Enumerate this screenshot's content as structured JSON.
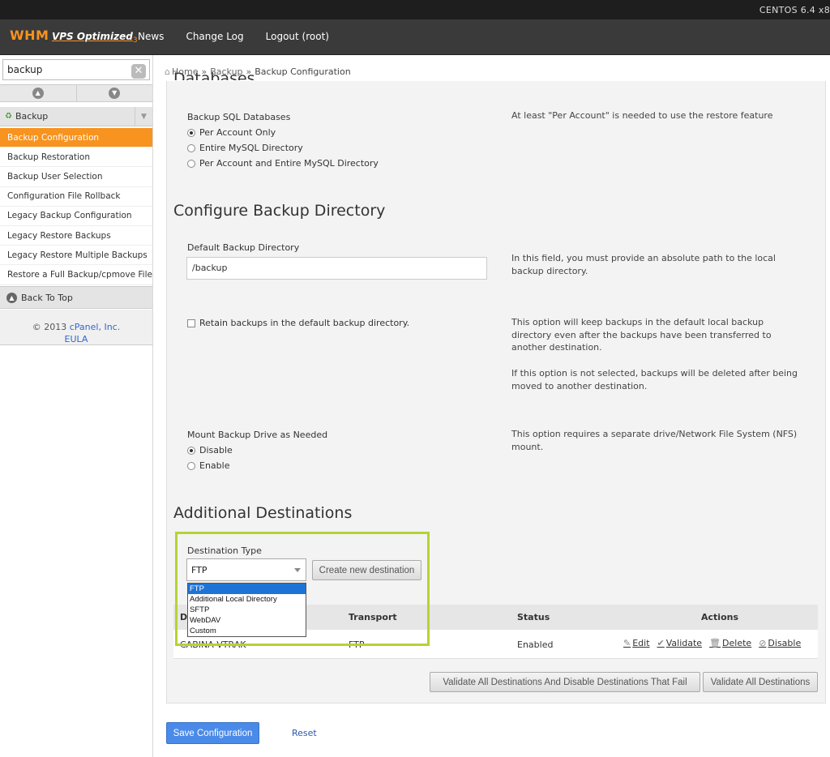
{
  "os": {
    "label": "CENTOS 6.4 x8"
  },
  "header": {
    "logo_whm": "WHM",
    "logo_vps": "VPS Optimized",
    "logo_version": "3",
    "nav": [
      "News",
      "Change Log",
      "Logout (root)"
    ]
  },
  "sidebar": {
    "search_value": "backup",
    "clear_glyph": "✕",
    "group_label": "Backup",
    "items": [
      "Backup Configuration",
      "Backup Restoration",
      "Backup User Selection",
      "Configuration File Rollback",
      "Legacy Backup Configuration",
      "Legacy Restore Backups",
      "Legacy Restore Multiple Backups",
      "Restore a Full Backup/cpmove File"
    ],
    "active_index": 0,
    "back_to_top": "Back To Top",
    "copyright_prefix": "© 2013 ",
    "copyright_link": "cPanel, Inc.",
    "eula": "EULA"
  },
  "breadcrumb": {
    "home": "Home",
    "sep": "»",
    "items": [
      "Backup",
      "Backup Configuration"
    ]
  },
  "clipped_section_title": "Databases",
  "sql": {
    "label": "Backup SQL Databases",
    "options": [
      "Per Account Only",
      "Entire MySQL Directory",
      "Per Account and Entire MySQL Directory"
    ],
    "selected": 0,
    "help": "At least \"Per Account\" is needed to use the restore feature"
  },
  "directory": {
    "title": "Configure Backup Directory",
    "label": "Default Backup Directory",
    "value": "/backup",
    "help": "In this field, you must provide an absolute path to the local backup directory.",
    "retain_label": "Retain backups in the default backup directory.",
    "retain_help_1": "This option will keep backups in the default local backup directory even after the backups have been transferred to another destination.",
    "retain_help_2": "If this option is not selected, backups will be deleted after being moved to another destination."
  },
  "mount": {
    "label": "Mount Backup Drive as Needed",
    "options": [
      "Disable",
      "Enable"
    ],
    "selected": 0,
    "help": "This option requires a separate drive/Network File System (NFS) mount."
  },
  "destinations": {
    "title": "Additional Destinations",
    "type_label": "Destination Type",
    "selected_type": "FTP",
    "type_options": [
      "FTP",
      "Additional Local Directory",
      "SFTP",
      "WebDAV",
      "Custom"
    ],
    "create_button": "Create new destination",
    "columns": [
      "D",
      "Transport",
      "Status",
      "Actions"
    ],
    "rows": [
      {
        "name": "CABINA VTRAK",
        "transport": "FTP",
        "status": "Enabled"
      }
    ],
    "actions": [
      "Edit",
      "Validate",
      "Delete",
      "Disable"
    ],
    "validate_disable_button": "Validate All Destinations And Disable Destinations That Fail",
    "validate_all_button": "Validate All Destinations"
  },
  "footer": {
    "save": "Save Configuration",
    "reset": "Reset"
  },
  "colors": {
    "accent": "#f7931e",
    "highlight": "#b5d334",
    "primary_button": "#4a8ae8",
    "link": "#3366cc"
  }
}
